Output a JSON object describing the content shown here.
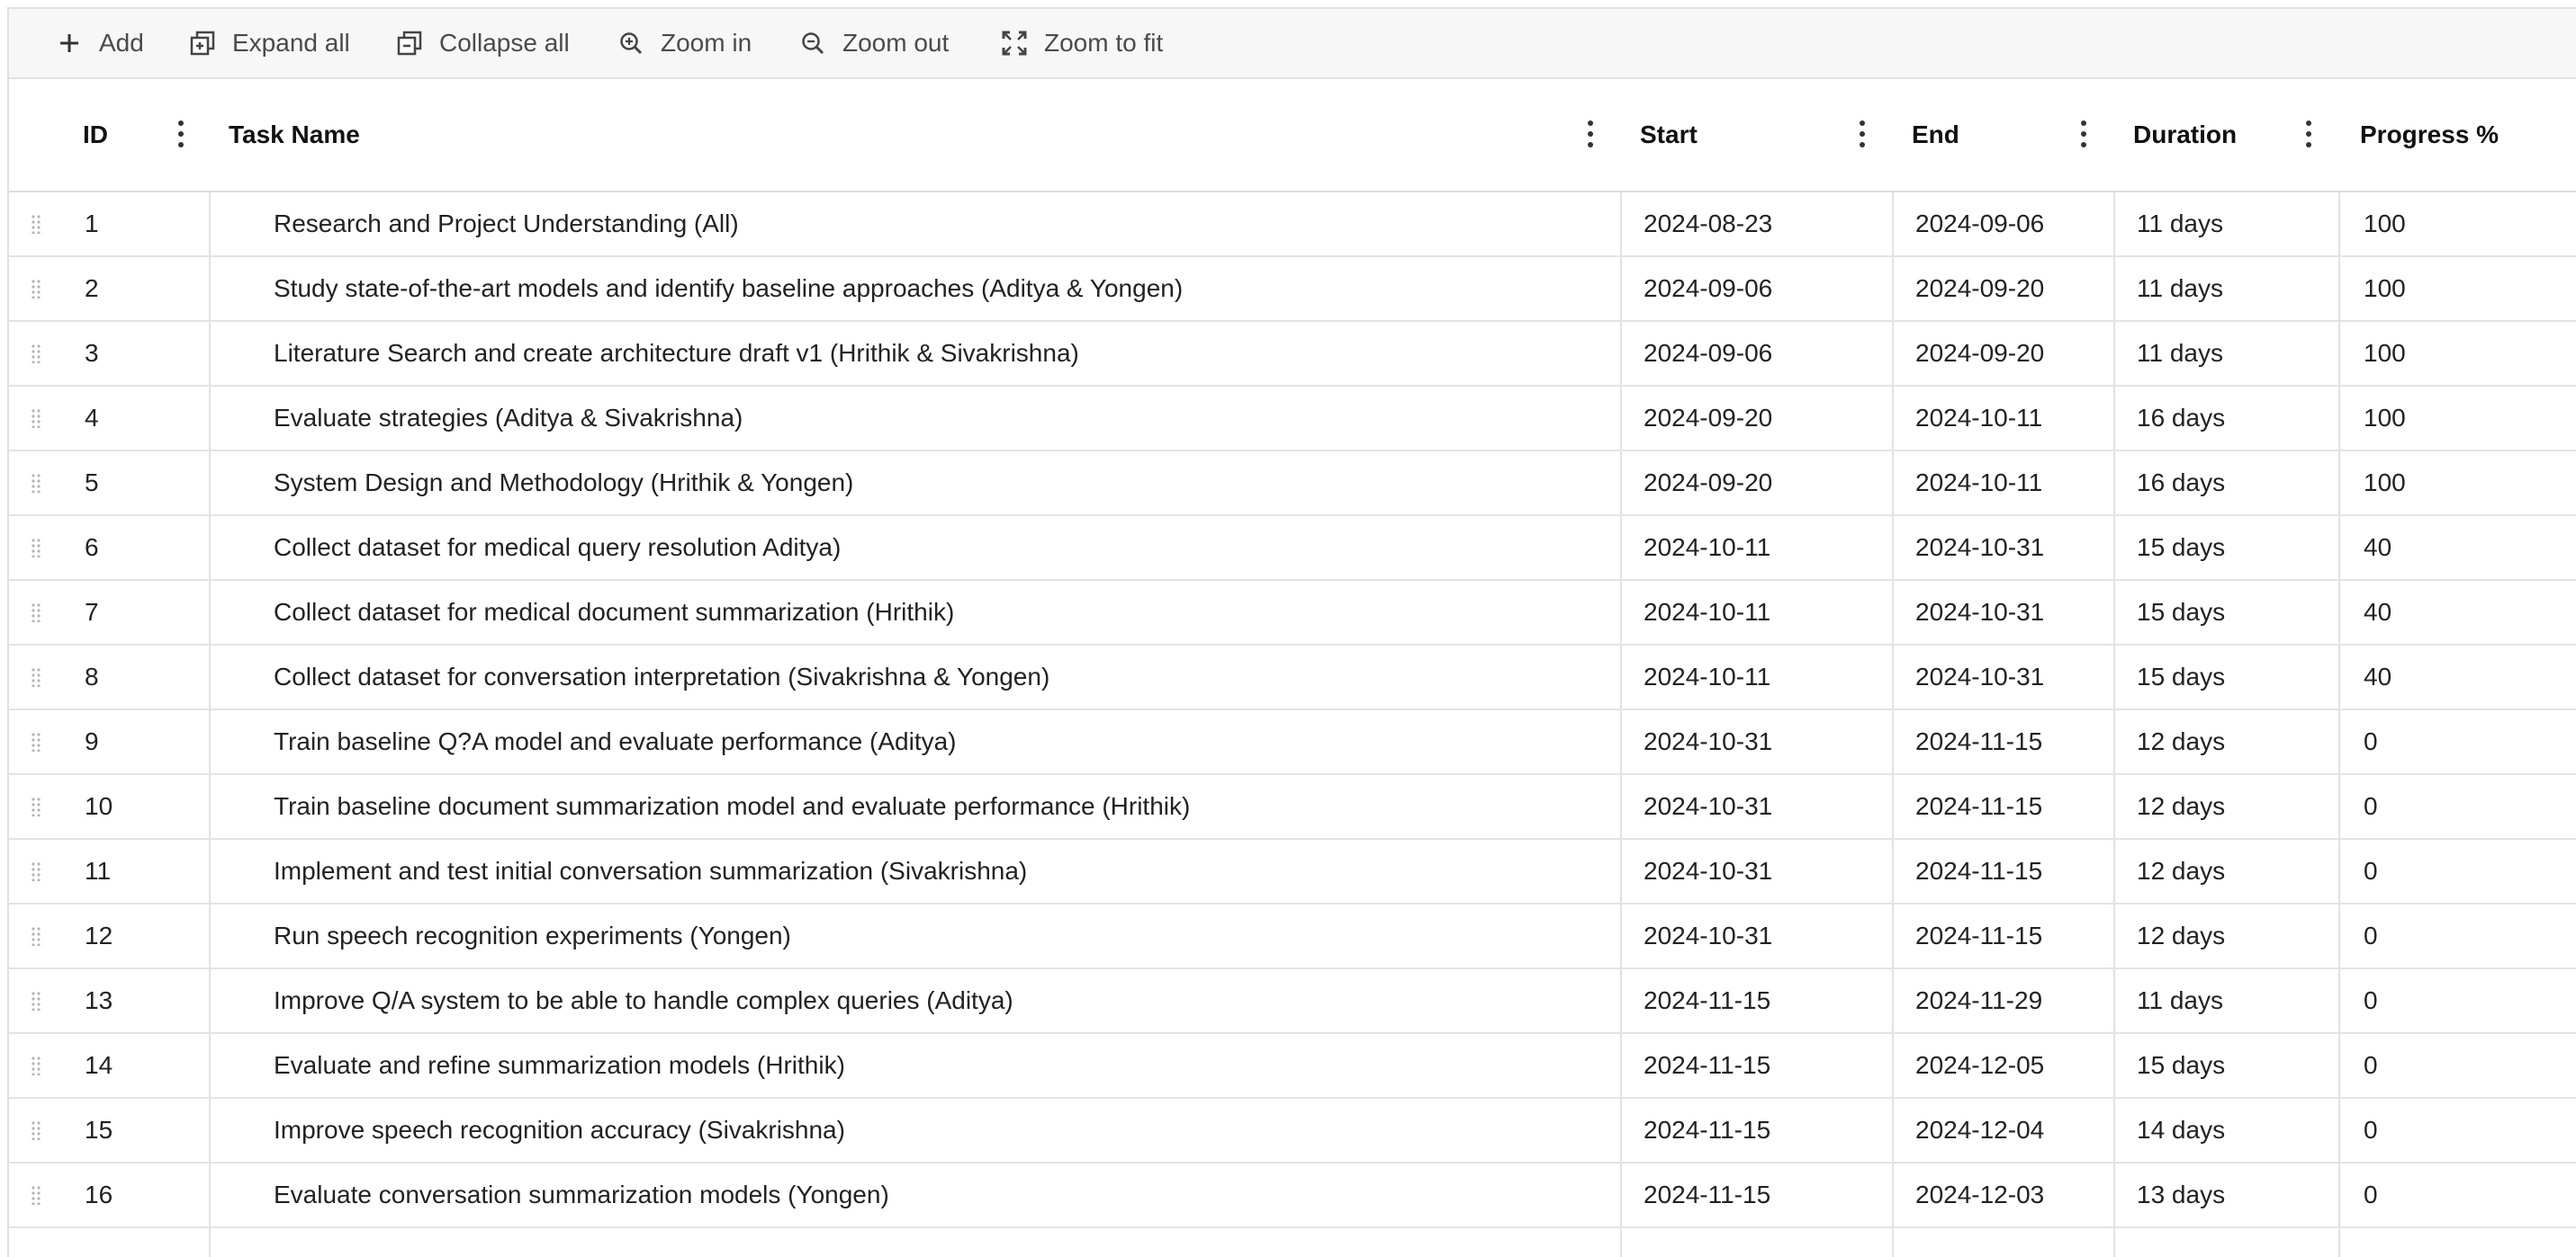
{
  "toolbar": {
    "add": {
      "label": "Add",
      "icon": "plus-icon"
    },
    "expand_all": {
      "label": "Expand all",
      "icon": "expand-all-icon"
    },
    "collapse_all": {
      "label": "Collapse all",
      "icon": "collapse-all-icon"
    },
    "zoom_in": {
      "label": "Zoom in",
      "icon": "zoom-in-icon"
    },
    "zoom_out": {
      "label": "Zoom out",
      "icon": "zoom-out-icon"
    },
    "zoom_to_fit": {
      "label": "Zoom to fit",
      "icon": "zoom-to-fit-icon"
    }
  },
  "columns": {
    "id": "ID",
    "task_name": "Task Name",
    "start": "Start",
    "end": "End",
    "duration": "Duration",
    "progress": "Progress %"
  },
  "rows": [
    {
      "id": "1",
      "name": "Research and Project Understanding (All)",
      "start": "2024-08-23",
      "end": "2024-09-06",
      "duration": "11 days",
      "progress": "100"
    },
    {
      "id": "2",
      "name": "Study state-of-the-art models and identify baseline approaches (Aditya & Yongen)",
      "start": "2024-09-06",
      "end": "2024-09-20",
      "duration": "11 days",
      "progress": "100"
    },
    {
      "id": "3",
      "name": "Literature Search and create architecture draft v1 (Hrithik & Sivakrishna)",
      "start": "2024-09-06",
      "end": "2024-09-20",
      "duration": "11 days",
      "progress": "100"
    },
    {
      "id": "4",
      "name": "Evaluate strategies (Aditya & Sivakrishna)",
      "start": "2024-09-20",
      "end": "2024-10-11",
      "duration": "16 days",
      "progress": "100"
    },
    {
      "id": "5",
      "name": "System Design and Methodology (Hrithik & Yongen)",
      "start": "2024-09-20",
      "end": "2024-10-11",
      "duration": "16 days",
      "progress": "100"
    },
    {
      "id": "6",
      "name": "Collect dataset for medical query resolution Aditya)",
      "start": "2024-10-11",
      "end": "2024-10-31",
      "duration": "15 days",
      "progress": "40"
    },
    {
      "id": "7",
      "name": "Collect dataset for medical document summarization (Hrithik)",
      "start": "2024-10-11",
      "end": "2024-10-31",
      "duration": "15 days",
      "progress": "40"
    },
    {
      "id": "8",
      "name": "Collect dataset for conversation interpretation (Sivakrishna & Yongen)",
      "start": "2024-10-11",
      "end": "2024-10-31",
      "duration": "15 days",
      "progress": "40"
    },
    {
      "id": "9",
      "name": "Train baseline Q?A model and evaluate performance (Aditya)",
      "start": "2024-10-31",
      "end": "2024-11-15",
      "duration": "12 days",
      "progress": "0"
    },
    {
      "id": "10",
      "name": "Train baseline document summarization model and evaluate performance (Hrithik)",
      "start": "2024-10-31",
      "end": "2024-11-15",
      "duration": "12 days",
      "progress": "0"
    },
    {
      "id": "11",
      "name": "Implement and test initial conversation summarization (Sivakrishna)",
      "start": "2024-10-31",
      "end": "2024-11-15",
      "duration": "12 days",
      "progress": "0"
    },
    {
      "id": "12",
      "name": "Run speech recognition experiments (Yongen)",
      "start": "2024-10-31",
      "end": "2024-11-15",
      "duration": "12 days",
      "progress": "0"
    },
    {
      "id": "13",
      "name": "Improve Q/A system to be able to handle complex queries (Aditya)",
      "start": "2024-11-15",
      "end": "2024-11-29",
      "duration": "11 days",
      "progress": "0"
    },
    {
      "id": "14",
      "name": "Evaluate and refine summarization models (Hrithik)",
      "start": "2024-11-15",
      "end": "2024-12-05",
      "duration": "15 days",
      "progress": "0"
    },
    {
      "id": "15",
      "name": "Improve speech recognition accuracy (Sivakrishna)",
      "start": "2024-11-15",
      "end": "2024-12-04",
      "duration": "14 days",
      "progress": "0"
    },
    {
      "id": "16",
      "name": "Evaluate conversation summarization models (Yongen)",
      "start": "2024-11-15",
      "end": "2024-12-03",
      "duration": "13 days",
      "progress": "0"
    }
  ]
}
